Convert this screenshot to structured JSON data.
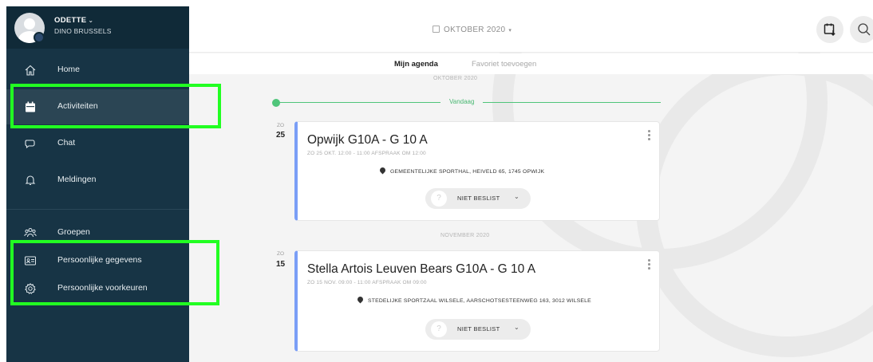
{
  "profile": {
    "name": "ODETTE",
    "name_caret": "⌄",
    "club": "DINO BRUSSELS"
  },
  "sidebar": {
    "items": [
      {
        "label": "Home",
        "icon": "home-icon"
      },
      {
        "label": "Activiteiten",
        "icon": "calendar-icon"
      },
      {
        "label": "Chat",
        "icon": "chat-icon"
      },
      {
        "label": "Meldingen",
        "icon": "bell-icon"
      },
      {
        "label": "Groepen",
        "icon": "groups-icon"
      },
      {
        "label": "Persoonlijke gegevens",
        "icon": "id-card-icon"
      },
      {
        "label": "Persoonlijke voorkeuren",
        "icon": "settings-gear-icon"
      }
    ]
  },
  "header": {
    "month": "OKTOBER 2020",
    "month_caret": "▾"
  },
  "tabs": {
    "active": "Mijn agenda",
    "inactive": "Favoriet toevoegen"
  },
  "timeline": {
    "month1": "OKTOBER 2020",
    "today": "Vandaag",
    "month2": "NOVEMBER 2020"
  },
  "events": [
    {
      "weekday": "ZO",
      "day": "25",
      "title": "Opwijk G10A - G 10 A",
      "meta": "ZO 25 OKT. 12:00 - 11:00 AFSPRAAK OM 12:00",
      "location": "GEMEENTELIJKE SPORTHAL, HEIVELD 65, 1745 OPWIJK",
      "status": "NIET BESLIST",
      "status_icon": "?",
      "status_caret": "⌄"
    },
    {
      "weekday": "ZO",
      "day": "15",
      "title": "Stella Artois Leuven Bears G10A - G 10 A",
      "meta": "ZO 15 NOV. 09:00 - 11:00 AFSPRAAK OM 09:00",
      "location": "STEDELIJKE SPORTZAAL WILSELE, AARSCHOTSESTEENWEG 163, 3012 WILSELE",
      "status": "NIET BESLIST",
      "status_icon": "?",
      "status_caret": "⌄"
    }
  ],
  "colors": {
    "sidebar": "#173445",
    "sidebar_active": "#2b4554",
    "accent_green": "#4fc57a",
    "card_border": "#7a9ef6",
    "highlight": "#22ff22"
  }
}
